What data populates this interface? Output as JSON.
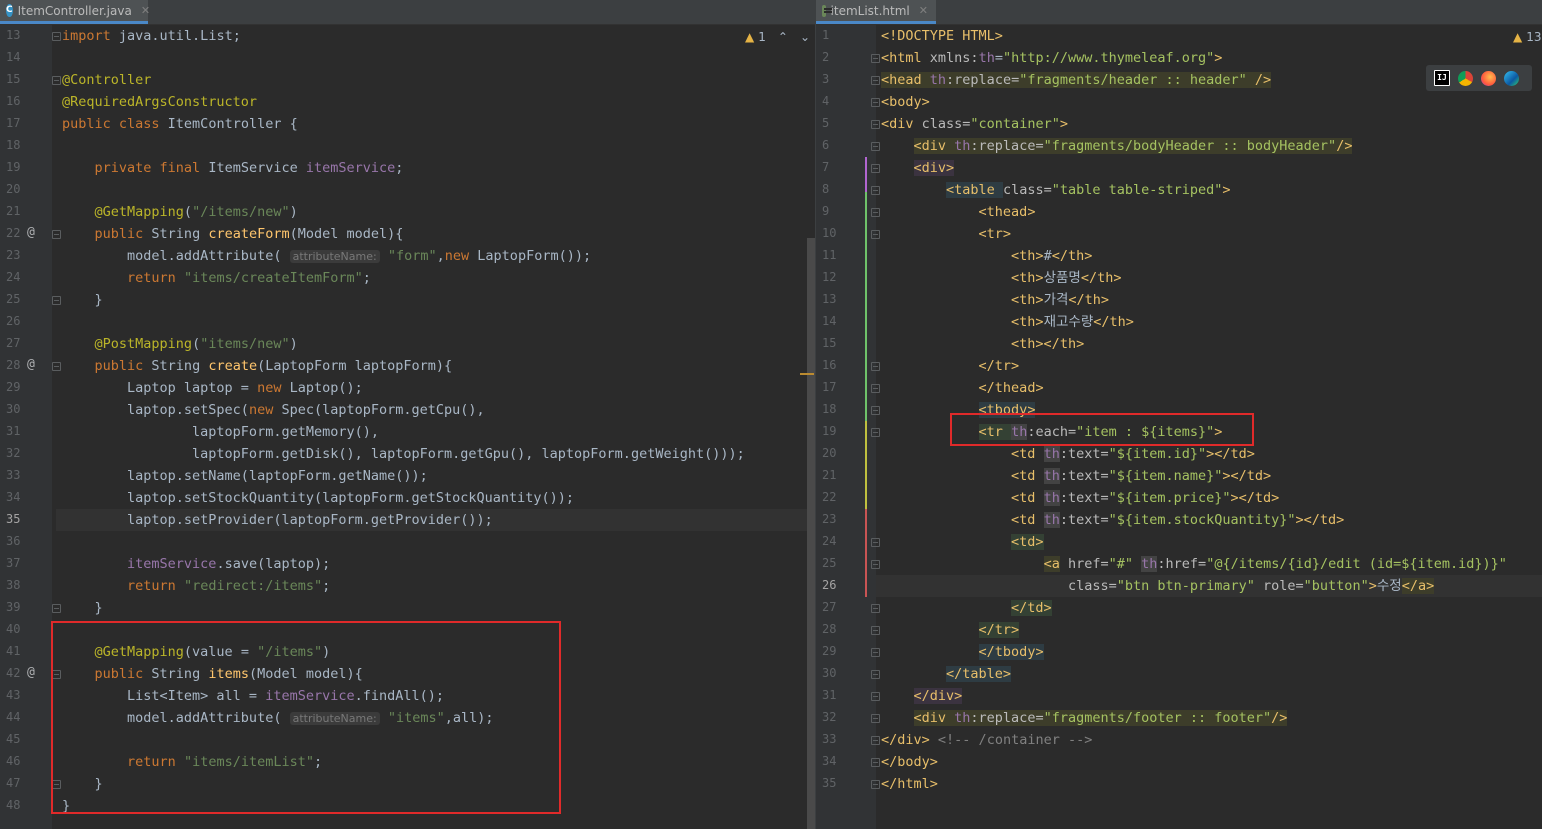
{
  "left_editor": {
    "tab_label": "ItemController.java",
    "warning_count": "1",
    "lines": [
      {
        "n": "13",
        "html": "<span class='kw'>import</span> java.util.List;"
      },
      {
        "n": "14",
        "html": ""
      },
      {
        "n": "15",
        "html": "<span class='an'>@Controller</span>"
      },
      {
        "n": "16",
        "html": "<span class='an'>@RequiredArgsConstructor</span>"
      },
      {
        "n": "17",
        "html": "<span class='kw'>public class</span> ItemController {"
      },
      {
        "n": "18",
        "html": ""
      },
      {
        "n": "19",
        "html": "    <span class='kw'>private final</span> ItemService <span class='fd'>itemService</span>;"
      },
      {
        "n": "20",
        "html": ""
      },
      {
        "n": "21",
        "html": "    <span class='an'>@GetMapping</span>(<span class='st'>\"/items/new\"</span>)"
      },
      {
        "n": "22",
        "html": "    <span class='kw'>public</span> String <span class='mt'>createForm</span>(Model model){"
      },
      {
        "n": "23",
        "html": "        model.addAttribute( <span class='hint'>attributeName:</span> <span class='st'>\"form\"</span>,<span class='kw'>new</span> LaptopForm());"
      },
      {
        "n": "24",
        "html": "        <span class='kw'>return</span> <span class='st'>\"items/createItemForm\"</span>;"
      },
      {
        "n": "25",
        "html": "    }"
      },
      {
        "n": "26",
        "html": ""
      },
      {
        "n": "27",
        "html": "    <span class='an'>@PostMapping</span>(<span class='st'>\"items/new\"</span>)"
      },
      {
        "n": "28",
        "html": "    <span class='kw'>public</span> String <span class='mt'>create</span>(LaptopForm laptopForm){"
      },
      {
        "n": "29",
        "html": "        Laptop laptop = <span class='kw'>new</span> Laptop();"
      },
      {
        "n": "30",
        "html": "        laptop.setSpec(<span class='kw'>new</span> Spec(laptopForm.getCpu(),"
      },
      {
        "n": "31",
        "html": "                laptopForm.getMemory(),"
      },
      {
        "n": "32",
        "html": "                laptopForm.getDisk(), laptopForm.getGpu(), laptopForm.getWeight()));"
      },
      {
        "n": "33",
        "html": "        laptop.setName(laptopForm.getName());"
      },
      {
        "n": "34",
        "html": "        laptop.setStockQuantity(laptopForm.getStockQuantity());"
      },
      {
        "n": "35",
        "html": "        laptop.setProvider(laptopForm.getProvider());"
      },
      {
        "n": "36",
        "html": ""
      },
      {
        "n": "37",
        "html": "        <span class='fd'>itemService</span>.save(laptop);"
      },
      {
        "n": "38",
        "html": "        <span class='kw'>return</span> <span class='st'>\"redirect:/items\"</span>;"
      },
      {
        "n": "39",
        "html": "    }"
      },
      {
        "n": "40",
        "html": ""
      },
      {
        "n": "41",
        "html": "    <span class='an'>@GetMapping</span>(value = <span class='st'>\"/items\"</span>)"
      },
      {
        "n": "42",
        "html": "    <span class='kw'>public</span> String <span class='mt'>items</span>(Model model){"
      },
      {
        "n": "43",
        "html": "        List&lt;Item&gt; all = <span class='fd'>itemService</span>.findAll();"
      },
      {
        "n": "44",
        "html": "        model.addAttribute( <span class='hint'>attributeName:</span> <span class='st'>\"items\"</span>,all);"
      },
      {
        "n": "45",
        "html": ""
      },
      {
        "n": "46",
        "html": "        <span class='kw'>return</span> <span class='st'>\"items/itemList\"</span>;"
      },
      {
        "n": "47",
        "html": "    }"
      },
      {
        "n": "48",
        "html": "}"
      }
    ]
  },
  "right_editor": {
    "tab_label": "itemList.html",
    "warning_count": "13",
    "lines": [
      {
        "n": "1",
        "html": "<span class='tg'>&lt;!DOCTYPE HTML&gt;</span>"
      },
      {
        "n": "2",
        "html": "<span class='tg'>&lt;html </span><span class='at2'>xmlns:</span><span class='th'>th</span>=<span class='av'>\"http://www.thymeleaf.org\"</span><span class='tg'>&gt;</span>"
      },
      {
        "n": "3",
        "html": "<span class='hl-tag'><span class='tg'>&lt;head </span><span class='th'>th</span><span class='at2'>:replace=</span><span class='av'>\"fragments/header :: header\"</span> <span class='tg'>/&gt;</span></span>"
      },
      {
        "n": "4",
        "html": "<span class='tg'>&lt;body&gt;</span>"
      },
      {
        "n": "5",
        "html": "<span class='tg'>&lt;div </span><span class='at2'>class=</span><span class='av'>\"container\"</span><span class='tg'>&gt;</span>"
      },
      {
        "n": "6",
        "html": "    <span class='hl-tag'><span class='tg'>&lt;div </span><span class='th'>th</span><span class='at2'>:replace=</span><span class='av'>\"fragments/bodyHeader :: bodyHeader\"</span><span class='tg'>/&gt;</span></span>"
      },
      {
        "n": "7",
        "html": "    <span class='hl-tag3'><span class='tg'>&lt;div&gt;</span></span>"
      },
      {
        "n": "8",
        "html": "        <span class='hl-tag4'><span class='tg'>&lt;table </span></span><span class='at2'>class=</span><span class='av'>\"table table-striped\"</span><span class='tg'>&gt;</span>"
      },
      {
        "n": "9",
        "html": "            <span class='tg'>&lt;thead&gt;</span>"
      },
      {
        "n": "10",
        "html": "            <span class='tg'>&lt;tr&gt;</span>"
      },
      {
        "n": "11",
        "html": "                <span class='tg'>&lt;th&gt;</span>#<span class='tg'>&lt;/th&gt;</span>"
      },
      {
        "n": "12",
        "html": "                <span class='tg'>&lt;th&gt;</span>상품명<span class='tg'>&lt;/th&gt;</span>"
      },
      {
        "n": "13",
        "html": "                <span class='tg'>&lt;th&gt;</span>가격<span class='tg'>&lt;/th&gt;</span>"
      },
      {
        "n": "14",
        "html": "                <span class='tg'>&lt;th&gt;</span>재고수량<span class='tg'>&lt;/th&gt;</span>"
      },
      {
        "n": "15",
        "html": "                <span class='tg'>&lt;th&gt;&lt;/th&gt;</span>"
      },
      {
        "n": "16",
        "html": "            <span class='tg'>&lt;/tr&gt;</span>"
      },
      {
        "n": "17",
        "html": "            <span class='tg'>&lt;/thead&gt;</span>"
      },
      {
        "n": "18",
        "html": "            <span class='hl-tag4'><span class='tg'>&lt;tbody&gt;</span></span>"
      },
      {
        "n": "19",
        "html": "            <span class='hl-tag2'><span class='tg'>&lt;tr </span></span><span class='hl-thattr'><span class='th'>th</span></span><span class='at2'>:each=</span><span class='av'>\"item : ${items}\"</span><span class='tg'>&gt;</span>"
      },
      {
        "n": "20",
        "html": "                <span class='tg'>&lt;td </span><span class='hl-thattr'><span class='th'>th</span></span><span class='at2'>:text=</span><span class='av'>\"${item.id}\"</span><span class='tg'>&gt;&lt;/td&gt;</span>"
      },
      {
        "n": "21",
        "html": "                <span class='tg'>&lt;td </span><span class='hl-thattr'><span class='th'>th</span></span><span class='at2'>:text=</span><span class='av'>\"${item.name}\"</span><span class='tg'>&gt;&lt;/td&gt;</span>"
      },
      {
        "n": "22",
        "html": "                <span class='tg'>&lt;td </span><span class='hl-thattr'><span class='th'>th</span></span><span class='at2'>:text=</span><span class='av'>\"${item.price}\"</span><span class='tg'>&gt;&lt;/td&gt;</span>"
      },
      {
        "n": "23",
        "html": "                <span class='tg'>&lt;td </span><span class='hl-thattr'><span class='th'>th</span></span><span class='at2'>:text=</span><span class='av'>\"${item.stockQuantity}\"</span><span class='tg'>&gt;&lt;/td&gt;</span>"
      },
      {
        "n": "24",
        "html": "                <span class='hl-tag2'><span class='tg'>&lt;td&gt;</span></span>"
      },
      {
        "n": "25",
        "html": "                    <span class='hl-tag'><span class='tg'>&lt;a</span></span> <span class='at2'>href=</span><span class='av'>\"#\"</span> <span class='hl-thattr'><span class='th'>th</span></span><span class='at2'>:href=</span><span class='av'>\"@{/items/{id}/edit (id=${item.id})}\"</span>"
      },
      {
        "n": "26",
        "html": "                       <span class='at2'>class=</span><span class='av'>\"btn btn-primary\"</span> <span class='at2'>role=</span><span class='av'>\"button\"</span><span class='tg'>&gt;</span>수정<span class='hl-tag'><span class='tg'>&lt;/a&gt;</span></span>"
      },
      {
        "n": "27",
        "html": "                <span class='hl-tag2'><span class='tg'>&lt;/td&gt;</span></span>"
      },
      {
        "n": "28",
        "html": "            <span class='hl-tag2'><span class='tg'>&lt;/tr&gt;</span></span>"
      },
      {
        "n": "29",
        "html": "            <span class='hl-tag4'><span class='tg'>&lt;/tbody&gt;</span></span>"
      },
      {
        "n": "30",
        "html": "        <span class='hl-tag4'><span class='tg'>&lt;/table&gt;</span></span>"
      },
      {
        "n": "31",
        "html": "    <span class='hl-tag3'><span class='tg'>&lt;/div&gt;</span></span>"
      },
      {
        "n": "32",
        "html": "    <span class='hl-tag'><span class='tg'>&lt;div </span><span class='th'>th</span><span class='at2'>:replace=</span><span class='av'>\"fragments/footer :: footer\"</span><span class='tg'>/&gt;</span></span>"
      },
      {
        "n": "33",
        "html": "<span class='tg'>&lt;/div&gt;</span> <span class='cm'>&lt;!-- /container --&gt;</span>"
      },
      {
        "n": "34",
        "html": "<span class='tg'>&lt;/body&gt;</span>"
      },
      {
        "n": "35",
        "html": "<span class='tg'>&lt;/html&gt;</span>"
      }
    ]
  },
  "browser_icons": [
    "intellij-icon",
    "chrome-icon",
    "firefox-icon",
    "edge-icon"
  ],
  "colors": {
    "highlight_box": "#e02a2a",
    "editor_bg": "#2b2b2b"
  }
}
